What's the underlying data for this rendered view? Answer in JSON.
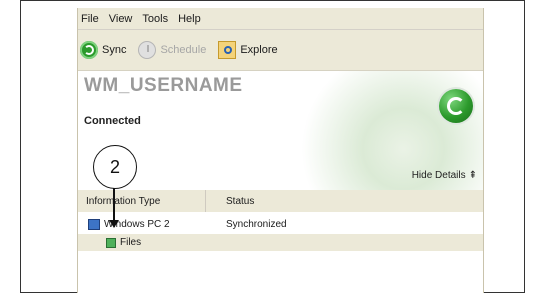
{
  "menu": {
    "file": "File",
    "view": "View",
    "tools": "Tools",
    "help": "Help"
  },
  "toolbar": {
    "sync": {
      "label": "Sync",
      "icon": "sync-icon",
      "color": "#2c9a2c"
    },
    "schedule": {
      "label": "Schedule",
      "icon": "clock-icon"
    },
    "explore": {
      "label": "Explore",
      "icon": "explore-icon"
    }
  },
  "device": {
    "username": "WM_USERNAME",
    "status": "Connected",
    "hide_details": "Hide Details",
    "hide_details_icon": "double-chevron-up-icon"
  },
  "list": {
    "headers": {
      "info_type": "Information Type",
      "status": "Status"
    },
    "rows": [
      {
        "name": "Windows PC 2",
        "status": "Synchronized",
        "icon": "computer-icon"
      },
      {
        "name": "Files",
        "status": "",
        "icon": "files-icon"
      }
    ]
  },
  "callout": {
    "number": "2"
  }
}
